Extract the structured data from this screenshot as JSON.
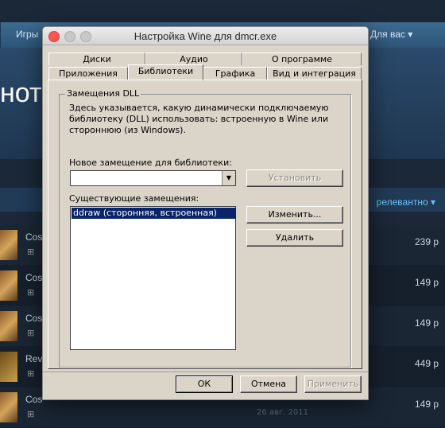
{
  "background": {
    "nav": {
      "games": "Игры",
      "for_you": "Для вас"
    },
    "heading": "нотр",
    "sort_label": "релевантно",
    "rows": [
      {
        "name": "Cos",
        "price": "239 р",
        "date": ""
      },
      {
        "name": "Cos",
        "price": "149 р",
        "date": ""
      },
      {
        "name": "Cos",
        "price": "149 р",
        "date": ""
      },
      {
        "name": "Rev",
        "price": "449 р",
        "date": ""
      },
      {
        "name": "Cos",
        "price": "149 р",
        "date": "26 авг. 2011"
      }
    ]
  },
  "dialog": {
    "title": "Настройка Wine для dmcr.exe",
    "tabs_top": [
      "Диски",
      "Аудио",
      "О программе"
    ],
    "tabs_bottom": [
      "Приложения",
      "Библиотеки",
      "Графика",
      "Вид и интеграция"
    ],
    "active_tab": "Библиотеки",
    "group_title": "Замещения DLL",
    "description": "Здесь указывается, какую динамически подключаемую библиотеку (DLL) использовать: встроенную в Wine или стороннюю (из Windows).",
    "new_override_label": "Новое замещение для библиотеки:",
    "new_override_value": "",
    "set_button": "Установить",
    "existing_label": "Существующие замещения:",
    "existing_items": [
      "ddraw (сторонняя, встроенная)"
    ],
    "edit_button": "Изменить...",
    "remove_button": "Удалить",
    "ok_button": "ОК",
    "cancel_button": "Отмена",
    "apply_button": "Применить"
  }
}
